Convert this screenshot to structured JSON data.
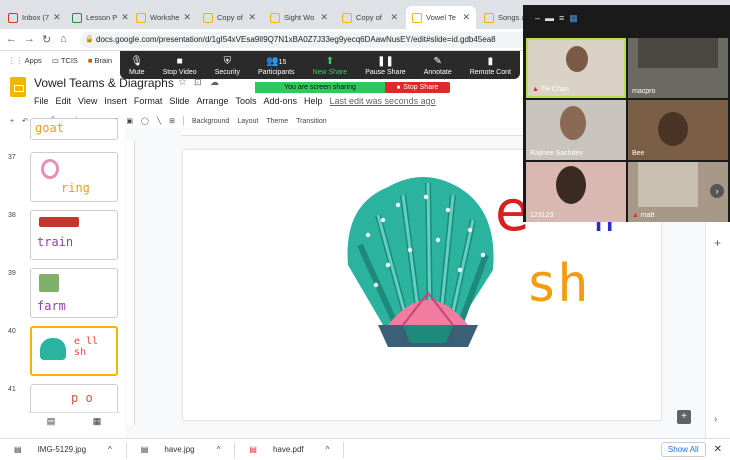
{
  "tabs": [
    {
      "label": "Inbox (7",
      "active": false
    },
    {
      "label": "Lesson P",
      "active": false
    },
    {
      "label": "Workshe",
      "active": false
    },
    {
      "label": "Copy of",
      "active": false
    },
    {
      "label": "Sight Wo",
      "active": false
    },
    {
      "label": "Copy of",
      "active": false
    },
    {
      "label": "Vowel Te",
      "active": true
    },
    {
      "label": "Songs a",
      "active": false
    }
  ],
  "url": "docs.google.com/presentation/d/1gI54xVEsa9lI9Q7N1xBA0Z7J33eg9yecq6DAawNusEY/edit#slide=id.gdb45ea8",
  "bookmarks": [
    "Apps",
    "TCIS",
    "Brain"
  ],
  "doc": {
    "title": "Vowel Teams & Diagraphs",
    "menus": [
      "File",
      "Edit",
      "View",
      "Insert",
      "Format",
      "Slide",
      "Arrange",
      "Tools",
      "Add-ons",
      "Help"
    ],
    "last_edit": "Last edit was seconds ago"
  },
  "toolbar": {
    "background": "Background",
    "layout": "Layout",
    "theme": "Theme",
    "transition": "Transition"
  },
  "slides": [
    {
      "num": "37",
      "word": "ring",
      "word_color": "#f39c12"
    },
    {
      "num": "38",
      "word": "train",
      "word_color": "#8e44ad"
    },
    {
      "num": "39",
      "word": "farm",
      "word_color": "#8e44ad"
    },
    {
      "num": "40",
      "word": "e ll sh",
      "word_color": "#e74c3c",
      "selected": true
    },
    {
      "num": "41",
      "word": "p o",
      "word_color": "#e74c3c"
    }
  ],
  "top_thumb_word": "goat",
  "slide_text": {
    "e": "e",
    "ll": "ll",
    "sh": "sh"
  },
  "zoom": {
    "buttons": [
      "Mute",
      "Stop Video",
      "Security",
      "Participants",
      "New Share",
      "Pause Share",
      "Annotate",
      "Remote Cont"
    ],
    "participant_count": "15",
    "sharing_status": "You are screen sharing",
    "stop_share": "Stop Share"
  },
  "participants": [
    "TH Chan",
    "macpro",
    "Rajinee Sachdev",
    "Bee",
    "123123",
    "matt"
  ],
  "downloads": [
    "IMG-5129.jpg",
    "have.jpg",
    "have.pdf"
  ],
  "show_all": "Show All",
  "colors": {
    "accent": "#f4b400",
    "zoom_green": "#2ec95c",
    "stop_red": "#e02828",
    "shell_teal": "#2bb3a0"
  }
}
